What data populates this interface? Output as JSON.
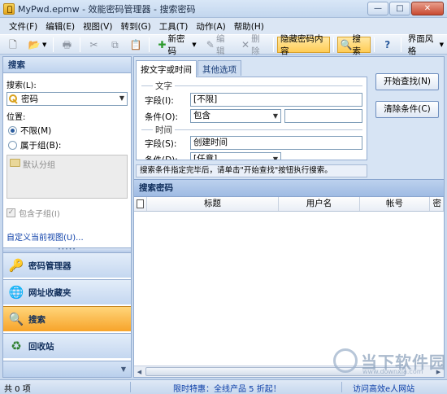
{
  "window": {
    "title": "MyPwd.epmw - 效能密码管理器 - 搜索密码",
    "min": "—",
    "max": "□",
    "close": "✕"
  },
  "menu": [
    "文件(F)",
    "编辑(E)",
    "视图(V)",
    "转到(G)",
    "工具(T)",
    "动作(A)",
    "帮助(H)"
  ],
  "toolbar": {
    "new_password": "新密码",
    "edit": "编辑",
    "delete": "删除",
    "hide_content": "隐藏密码内容",
    "search": "搜索",
    "style": "界面风格"
  },
  "left": {
    "header": "搜索",
    "search_label": "搜索(L):",
    "search_value": "密码",
    "position_label": "位置:",
    "radio_unlimited": "不限(M)",
    "radio_group": "属于组(B):",
    "default_group": "默认分组",
    "include_sub": "包含子组(I)",
    "custom_view": "自定义当前视图(U)...",
    "nav": {
      "password_manager": "密码管理器",
      "url_favorites": "网址收藏夹",
      "search": "搜索",
      "recycle": "回收站"
    }
  },
  "right": {
    "tab_text_time": "按文字或时间",
    "tab_other": "其他选项",
    "group_text": "文字",
    "field_label": "字段(I):",
    "field_value": "[不限]",
    "condition_label": "条件(O):",
    "condition_value": "包含",
    "condition_input": "",
    "group_time": "时间",
    "time_field_label": "字段(S):",
    "time_field_value": "创建时间",
    "time_condition_label": "条件(D):",
    "time_condition_value": "[任意]",
    "start_button": "开始查找(N)",
    "clear_button": "清除条件(C)",
    "hint": "搜索条件指定完毕后，请单击\"开始查找\"按钮执行搜索。",
    "result_title": "搜索密码",
    "columns": [
      "标题",
      "用户名",
      "帐号",
      "密"
    ]
  },
  "status": {
    "count": "共 0 项",
    "promo": "限时特惠：全线产品 5 折起！",
    "visit": "访问高效e人网站"
  },
  "watermark": {
    "text": "当下软件园",
    "sub": "www.downxia.com"
  },
  "colors": {
    "accent": "#f7a42a",
    "link": "#0b3ea8",
    "header": "#1a3a6b"
  }
}
